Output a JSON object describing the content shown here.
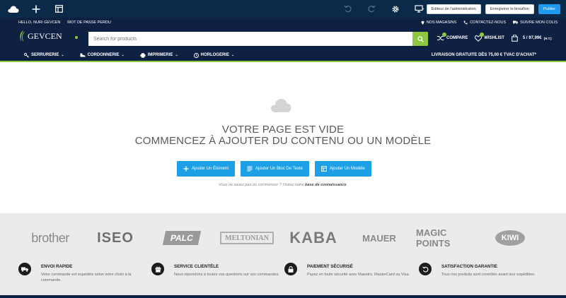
{
  "editor": {
    "admin_label": "Éditeur de l'administration",
    "save_draft_label": "Enregistrer le brouillon",
    "publish_label": "Publier"
  },
  "topbar": {
    "user": "HELLO, NURI GEVCEN",
    "forgot": "MOT DE PASSE PERDU",
    "stores": "NOS MAGASINS",
    "contact": "CONTACTEZ-NOUS",
    "track": "SUIVRE MON COLIS"
  },
  "header": {
    "logo": "GEVCEN",
    "search_placeholder": "Search for products",
    "compare": "COMPARE",
    "wishlist": "WISHLIST",
    "cart": "5 / 97,99€",
    "cart_tax": "(H.T.)"
  },
  "nav": {
    "items": [
      {
        "label": "SERRURERIE"
      },
      {
        "label": "CORDONNERIE"
      },
      {
        "label": "IMPRIMERIE"
      },
      {
        "label": "HORLOGERIE"
      }
    ],
    "promo": "LIVRAISON GRATUITE DÈS 75,00 € TVAC D'ACHAT*"
  },
  "empty": {
    "line1": "VOTRE PAGE EST VIDE",
    "line2": "COMMENCEZ À AJOUTER DU CONTENU OU UN MODÈLE",
    "btn_element": "Ajouter Un Élément",
    "btn_text": "Ajouter Un Bloc De Texte",
    "btn_template": "Ajouter Un Modèle",
    "hint_prefix": "Vous ne savez pas où commencer ? Visitez notre",
    "hint_link": "base de connaissance",
    "hint_suffix": "."
  },
  "brands": [
    "brother",
    "ISEO",
    "PALC",
    "MELTONIAN",
    "KABA",
    "MAUER",
    "MAGIC POINTS",
    "KIWI"
  ],
  "features": [
    {
      "title": "ENVOI RAPIDE",
      "desc": "Votre commande est expédiée selon votre choix à la commande.",
      "icon": "truck-icon"
    },
    {
      "title": "SERVICE CLIENTÈLE",
      "desc": "Nous répondons à toutes vos questions sur vos commandes.",
      "icon": "gift-icon"
    },
    {
      "title": "PAIEMENT SÉCURISÉ",
      "desc": "Payez en toute sécurité avec Maestro, MasterCard ou Visa.",
      "icon": "lock-icon"
    },
    {
      "title": "SATISFACTION GARANTIE",
      "desc": "Tous nos produits sont contrôlés avant leur expédition.",
      "icon": "return-icon"
    }
  ],
  "colors": {
    "navy": "#0f2143",
    "editor_bar": "#0b2a4a",
    "accent_green": "#8dc63f",
    "button_blue": "#1ea0e6"
  }
}
